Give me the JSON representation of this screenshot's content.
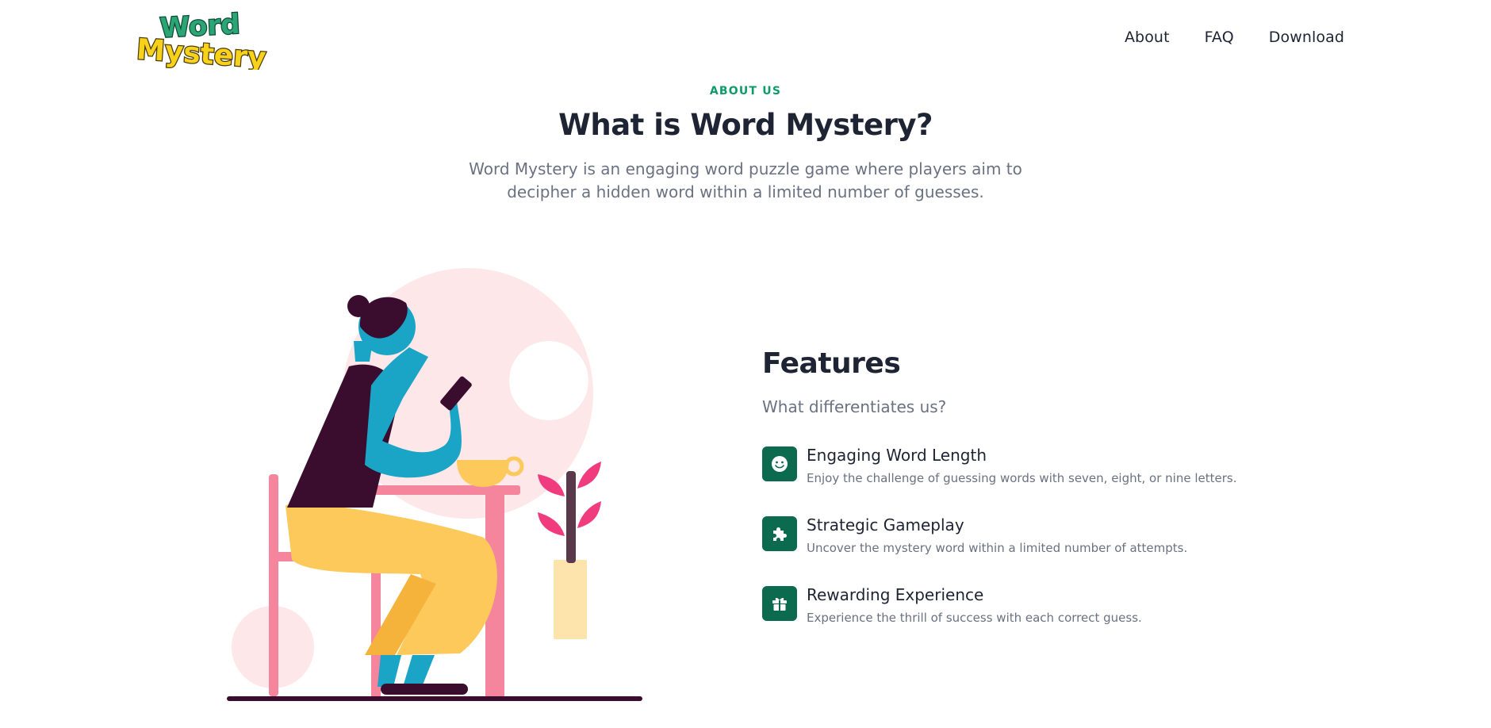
{
  "header": {
    "logo": {
      "line1": "Word",
      "line2": "Mystery"
    },
    "nav": [
      {
        "label": "About"
      },
      {
        "label": "FAQ"
      },
      {
        "label": "Download"
      }
    ]
  },
  "about": {
    "eyebrow": "ABOUT US",
    "title": "What is Word Mystery?",
    "description": "Word Mystery is an engaging word puzzle game where players aim to decipher a hidden word within a limited number of guesses."
  },
  "features": {
    "title": "Features",
    "subtitle": "What differentiates us?",
    "items": [
      {
        "icon": "smiley-icon",
        "title": "Engaging Word Length",
        "description": "Enjoy the challenge of guessing words with seven, eight, or nine letters."
      },
      {
        "icon": "puzzle-piece-icon",
        "title": "Strategic Gameplay",
        "description": "Uncover the mystery word within a limited number of attempts."
      },
      {
        "icon": "gift-icon",
        "title": "Rewarding Experience",
        "description": "Experience the thrill of success with each correct guess."
      }
    ]
  },
  "colors": {
    "accent": "#0f9a6b",
    "icon_bg": "#0c6b4f",
    "heading": "#1e2433",
    "body_text": "#6a7180"
  }
}
